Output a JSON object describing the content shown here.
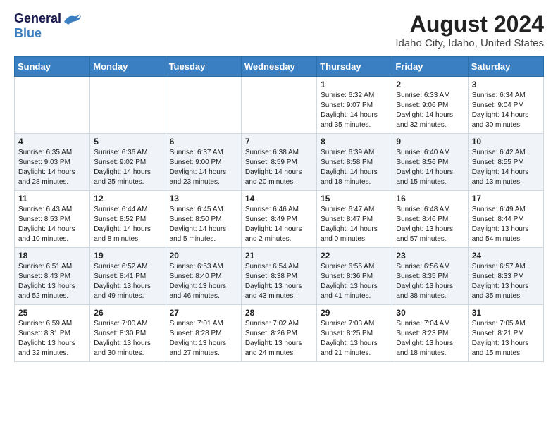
{
  "logo": {
    "general": "General",
    "blue": "Blue"
  },
  "title": "August 2024",
  "subtitle": "Idaho City, Idaho, United States",
  "days_of_week": [
    "Sunday",
    "Monday",
    "Tuesday",
    "Wednesday",
    "Thursday",
    "Friday",
    "Saturday"
  ],
  "weeks": [
    [
      {
        "day": "",
        "info": ""
      },
      {
        "day": "",
        "info": ""
      },
      {
        "day": "",
        "info": ""
      },
      {
        "day": "",
        "info": ""
      },
      {
        "day": "1",
        "info": "Sunrise: 6:32 AM\nSunset: 9:07 PM\nDaylight: 14 hours and 35 minutes."
      },
      {
        "day": "2",
        "info": "Sunrise: 6:33 AM\nSunset: 9:06 PM\nDaylight: 14 hours and 32 minutes."
      },
      {
        "day": "3",
        "info": "Sunrise: 6:34 AM\nSunset: 9:04 PM\nDaylight: 14 hours and 30 minutes."
      }
    ],
    [
      {
        "day": "4",
        "info": "Sunrise: 6:35 AM\nSunset: 9:03 PM\nDaylight: 14 hours and 28 minutes."
      },
      {
        "day": "5",
        "info": "Sunrise: 6:36 AM\nSunset: 9:02 PM\nDaylight: 14 hours and 25 minutes."
      },
      {
        "day": "6",
        "info": "Sunrise: 6:37 AM\nSunset: 9:00 PM\nDaylight: 14 hours and 23 minutes."
      },
      {
        "day": "7",
        "info": "Sunrise: 6:38 AM\nSunset: 8:59 PM\nDaylight: 14 hours and 20 minutes."
      },
      {
        "day": "8",
        "info": "Sunrise: 6:39 AM\nSunset: 8:58 PM\nDaylight: 14 hours and 18 minutes."
      },
      {
        "day": "9",
        "info": "Sunrise: 6:40 AM\nSunset: 8:56 PM\nDaylight: 14 hours and 15 minutes."
      },
      {
        "day": "10",
        "info": "Sunrise: 6:42 AM\nSunset: 8:55 PM\nDaylight: 14 hours and 13 minutes."
      }
    ],
    [
      {
        "day": "11",
        "info": "Sunrise: 6:43 AM\nSunset: 8:53 PM\nDaylight: 14 hours and 10 minutes."
      },
      {
        "day": "12",
        "info": "Sunrise: 6:44 AM\nSunset: 8:52 PM\nDaylight: 14 hours and 8 minutes."
      },
      {
        "day": "13",
        "info": "Sunrise: 6:45 AM\nSunset: 8:50 PM\nDaylight: 14 hours and 5 minutes."
      },
      {
        "day": "14",
        "info": "Sunrise: 6:46 AM\nSunset: 8:49 PM\nDaylight: 14 hours and 2 minutes."
      },
      {
        "day": "15",
        "info": "Sunrise: 6:47 AM\nSunset: 8:47 PM\nDaylight: 14 hours and 0 minutes."
      },
      {
        "day": "16",
        "info": "Sunrise: 6:48 AM\nSunset: 8:46 PM\nDaylight: 13 hours and 57 minutes."
      },
      {
        "day": "17",
        "info": "Sunrise: 6:49 AM\nSunset: 8:44 PM\nDaylight: 13 hours and 54 minutes."
      }
    ],
    [
      {
        "day": "18",
        "info": "Sunrise: 6:51 AM\nSunset: 8:43 PM\nDaylight: 13 hours and 52 minutes."
      },
      {
        "day": "19",
        "info": "Sunrise: 6:52 AM\nSunset: 8:41 PM\nDaylight: 13 hours and 49 minutes."
      },
      {
        "day": "20",
        "info": "Sunrise: 6:53 AM\nSunset: 8:40 PM\nDaylight: 13 hours and 46 minutes."
      },
      {
        "day": "21",
        "info": "Sunrise: 6:54 AM\nSunset: 8:38 PM\nDaylight: 13 hours and 43 minutes."
      },
      {
        "day": "22",
        "info": "Sunrise: 6:55 AM\nSunset: 8:36 PM\nDaylight: 13 hours and 41 minutes."
      },
      {
        "day": "23",
        "info": "Sunrise: 6:56 AM\nSunset: 8:35 PM\nDaylight: 13 hours and 38 minutes."
      },
      {
        "day": "24",
        "info": "Sunrise: 6:57 AM\nSunset: 8:33 PM\nDaylight: 13 hours and 35 minutes."
      }
    ],
    [
      {
        "day": "25",
        "info": "Sunrise: 6:59 AM\nSunset: 8:31 PM\nDaylight: 13 hours and 32 minutes."
      },
      {
        "day": "26",
        "info": "Sunrise: 7:00 AM\nSunset: 8:30 PM\nDaylight: 13 hours and 30 minutes."
      },
      {
        "day": "27",
        "info": "Sunrise: 7:01 AM\nSunset: 8:28 PM\nDaylight: 13 hours and 27 minutes."
      },
      {
        "day": "28",
        "info": "Sunrise: 7:02 AM\nSunset: 8:26 PM\nDaylight: 13 hours and 24 minutes."
      },
      {
        "day": "29",
        "info": "Sunrise: 7:03 AM\nSunset: 8:25 PM\nDaylight: 13 hours and 21 minutes."
      },
      {
        "day": "30",
        "info": "Sunrise: 7:04 AM\nSunset: 8:23 PM\nDaylight: 13 hours and 18 minutes."
      },
      {
        "day": "31",
        "info": "Sunrise: 7:05 AM\nSunset: 8:21 PM\nDaylight: 13 hours and 15 minutes."
      }
    ]
  ]
}
